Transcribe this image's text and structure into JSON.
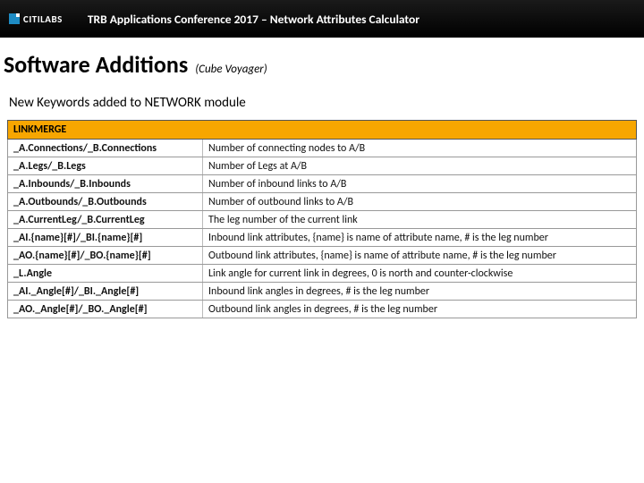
{
  "header": {
    "brand": "CITILABS",
    "title": "TRB Applications Conference 2017 – Network Attributes Calculator"
  },
  "heading": {
    "main": "Software Additions",
    "sub": "(Cube Voyager)"
  },
  "lead": "New Keywords added to NETWORK module",
  "table": {
    "section": "LINKMERGE",
    "rows": [
      {
        "k": "_A.Connections/_B.Connections",
        "d": "Number of connecting nodes to A/B"
      },
      {
        "k": "_A.Legs/_B.Legs",
        "d": "Number of Legs at A/B"
      },
      {
        "k": "_A.Inbounds/_B.Inbounds",
        "d": "Number of inbound links to A/B"
      },
      {
        "k": "_A.Outbounds/_B.Outbounds",
        "d": "Number of outbound links to A/B"
      },
      {
        "k": "_A.CurrentLeg/_B.CurrentLeg",
        "d": "The leg number of the current link"
      },
      {
        "k": "_AI.{name}[#]/_BI.{name}[#]",
        "d": "Inbound link attributes, {name} is name of attribute name, # is the leg number"
      },
      {
        "k": "_AO.{name}[#]/_BO.{name}[#]",
        "d": "Outbound link attributes, {name} is name of attribute name, # is the leg number"
      },
      {
        "k": "_L.Angle",
        "d": "Link angle for current link in degrees, 0 is north and counter-clockwise"
      },
      {
        "k": "_AI._Angle[#]/_BI._Angle[#]",
        "d": "Inbound link angles in degrees, # is the leg number"
      },
      {
        "k": "_AO._Angle[#]/_BO._Angle[#]",
        "d": "Outbound link angles in degrees, # is the leg number"
      }
    ]
  }
}
